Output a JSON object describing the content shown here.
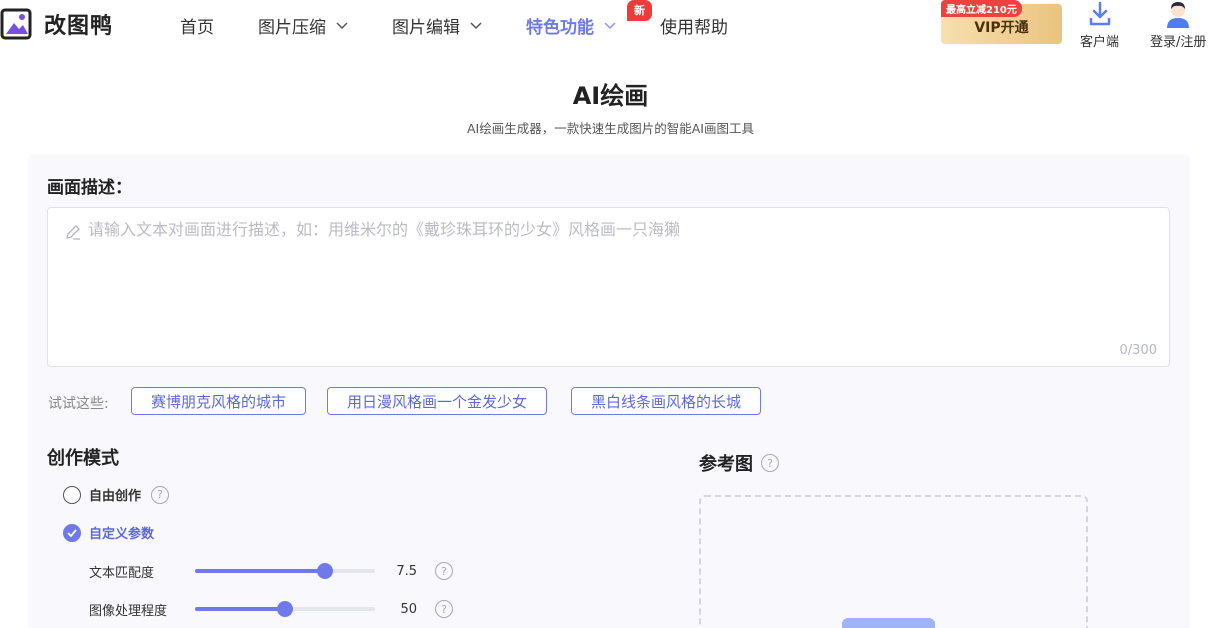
{
  "brand": {
    "name": "改图鸭"
  },
  "nav": [
    {
      "label": "首页",
      "dropdown": false,
      "active": false
    },
    {
      "label": "图片压缩",
      "dropdown": true,
      "active": false
    },
    {
      "label": "图片编辑",
      "dropdown": true,
      "active": false
    },
    {
      "label": "特色功能",
      "dropdown": true,
      "active": true,
      "badge": "新"
    },
    {
      "label": "使用帮助",
      "dropdown": false,
      "active": false
    }
  ],
  "vip": {
    "tag": "最高立减210元",
    "label": "VIP开通"
  },
  "header_actions": {
    "client": "客户端",
    "login": "登录/注册"
  },
  "page": {
    "title": "AI绘画",
    "subtitle": "AI绘画生成器，一款快速生成图片的智能AI画图工具"
  },
  "description": {
    "label": "画面描述：",
    "value": "",
    "placeholder": "请输入文本对画面进行描述，如：用维米尔的《戴珍珠耳环的少女》风格画一只海獭",
    "counter": "0/300"
  },
  "suggestions": {
    "label": "试试这些:",
    "items": [
      "赛博朋克风格的城市",
      "用日漫风格画一个金发少女",
      "黑白线条画风格的长城"
    ]
  },
  "mode": {
    "label": "创作模式",
    "options": [
      {
        "label": "自由创作",
        "checked": false
      },
      {
        "label": "自定义参数",
        "checked": true
      }
    ]
  },
  "params": [
    {
      "label": "文本匹配度",
      "value": "7.5",
      "fraction": 0.72
    },
    {
      "label": "图像处理程度",
      "value": "50",
      "fraction": 0.5
    }
  ],
  "reference": {
    "label": "参考图"
  },
  "colors": {
    "accent": "#6f79ea",
    "badge": "#f03b3b",
    "vip_gold": "#eac47f"
  }
}
